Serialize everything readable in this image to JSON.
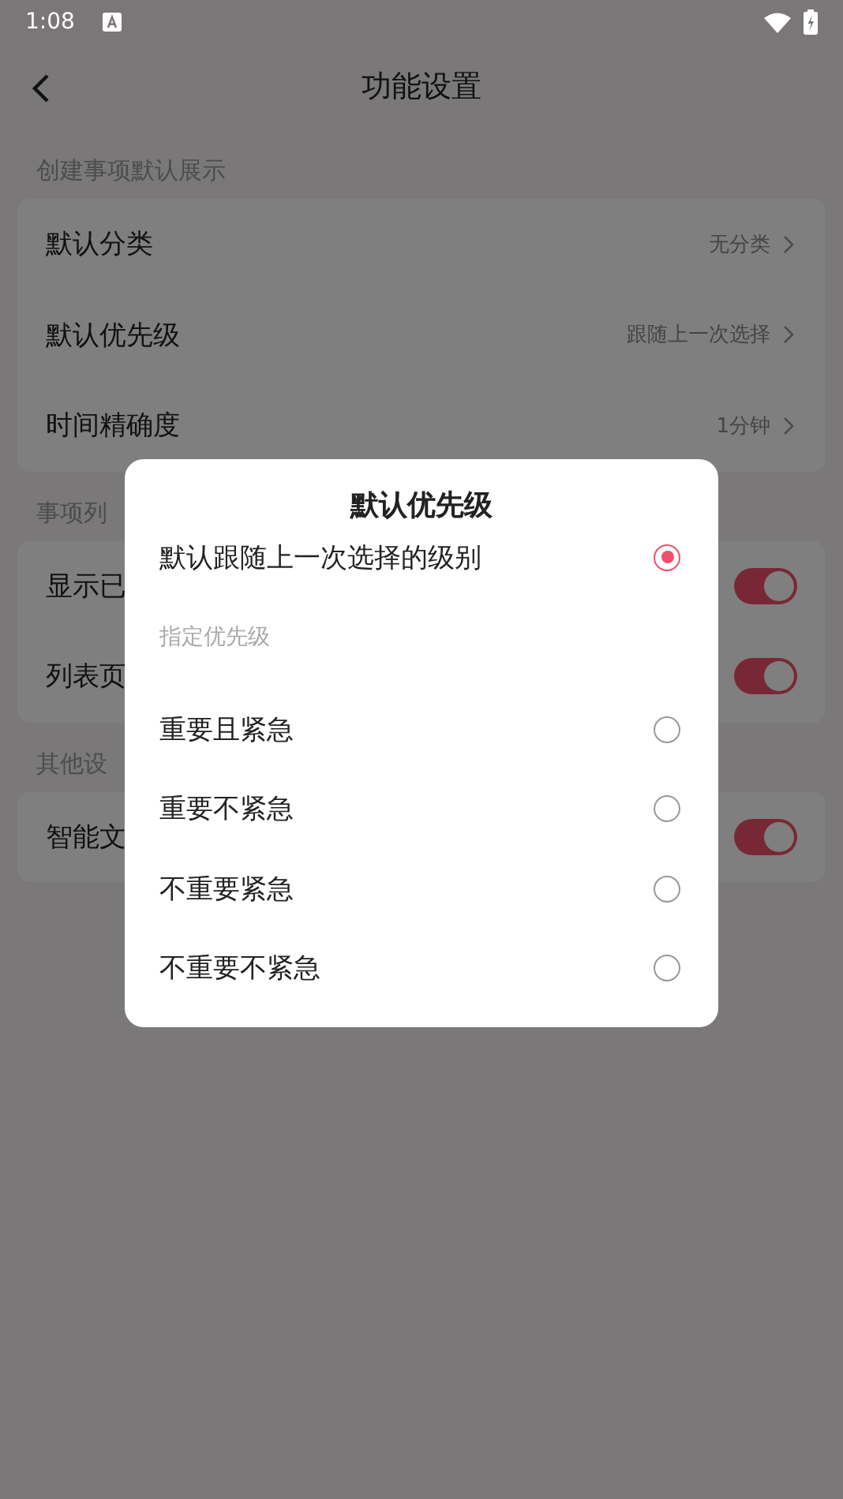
{
  "status_bar": {
    "time": "1:08"
  },
  "header": {
    "title": "功能设置"
  },
  "sections": [
    {
      "label": "创建事项默认展示",
      "rows": [
        {
          "kind": "link",
          "label": "默认分类",
          "value": "无分类"
        },
        {
          "kind": "link",
          "label": "默认优先级",
          "value": "跟随上一次选择"
        },
        {
          "kind": "link",
          "label": "时间精确度",
          "value": "1分钟"
        }
      ]
    },
    {
      "label": "事项列",
      "rows": [
        {
          "kind": "toggle",
          "label": "显示已",
          "on": true
        },
        {
          "kind": "toggle",
          "label": "列表页",
          "on": true
        }
      ]
    },
    {
      "label": "其他设",
      "rows": [
        {
          "kind": "toggle",
          "label": "智能文",
          "on": true
        }
      ]
    }
  ],
  "dialog": {
    "title": "默认优先级",
    "default_option": {
      "label": "默认跟随上一次选择的级别",
      "selected": true
    },
    "subheading": "指定优先级",
    "options": [
      {
        "label": "重要且紧急",
        "selected": false
      },
      {
        "label": "重要不紧急",
        "selected": false
      },
      {
        "label": "不重要紧急",
        "selected": false
      },
      {
        "label": "不重要不紧急",
        "selected": false
      }
    ]
  }
}
